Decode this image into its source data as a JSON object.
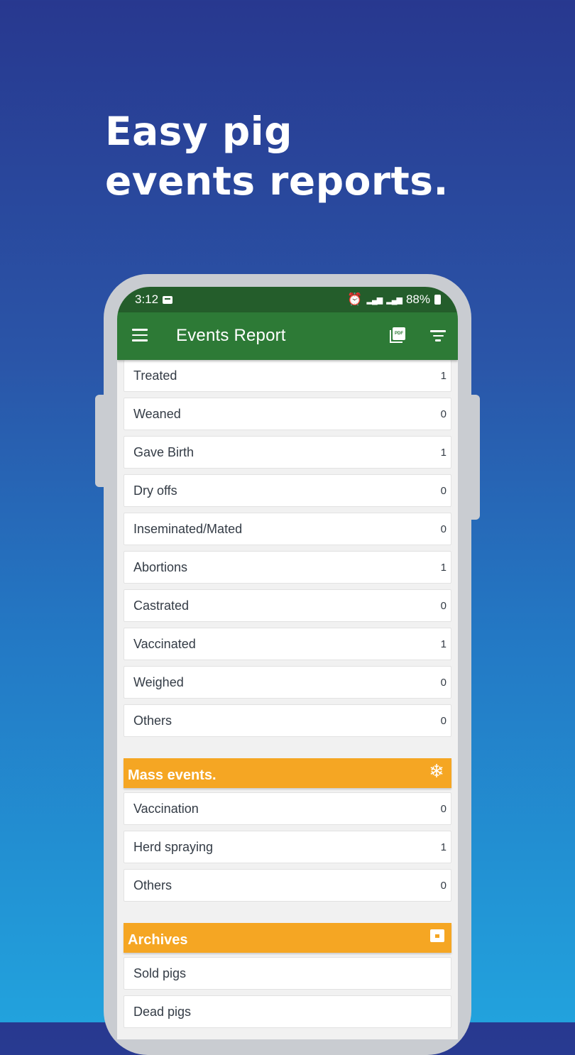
{
  "promo": {
    "headline_line1": "Easy pig",
    "headline_line2": "events reports."
  },
  "status_bar": {
    "time": "3:12",
    "battery": "88%"
  },
  "app_bar": {
    "title": "Events Report",
    "icons": [
      "menu-icon",
      "pdf-icon",
      "filter-icon"
    ]
  },
  "events": [
    {
      "label": "Treated",
      "count": "1"
    },
    {
      "label": "Weaned",
      "count": "0"
    },
    {
      "label": "Gave Birth",
      "count": "1"
    },
    {
      "label": "Dry offs",
      "count": "0"
    },
    {
      "label": "Inseminated/Mated",
      "count": "0"
    },
    {
      "label": "Abortions",
      "count": "1"
    },
    {
      "label": "Castrated",
      "count": "0"
    },
    {
      "label": "Vaccinated",
      "count": "1"
    },
    {
      "label": "Weighed",
      "count": "0"
    },
    {
      "label": "Others",
      "count": "0"
    }
  ],
  "mass_events": {
    "title": "Mass events.",
    "icon": "snowflake-icon",
    "items": [
      {
        "label": "Vaccination",
        "count": "0"
      },
      {
        "label": "Herd spraying",
        "count": "1"
      },
      {
        "label": "Others",
        "count": "0"
      }
    ]
  },
  "archives": {
    "title": "Archives",
    "icon": "archive-icon",
    "items": [
      {
        "label": "Sold pigs"
      },
      {
        "label": "Dead pigs"
      }
    ]
  },
  "colors": {
    "status_bar": "#245d2b",
    "app_bar": "#2d7a36",
    "section_header": "#f5a623"
  }
}
